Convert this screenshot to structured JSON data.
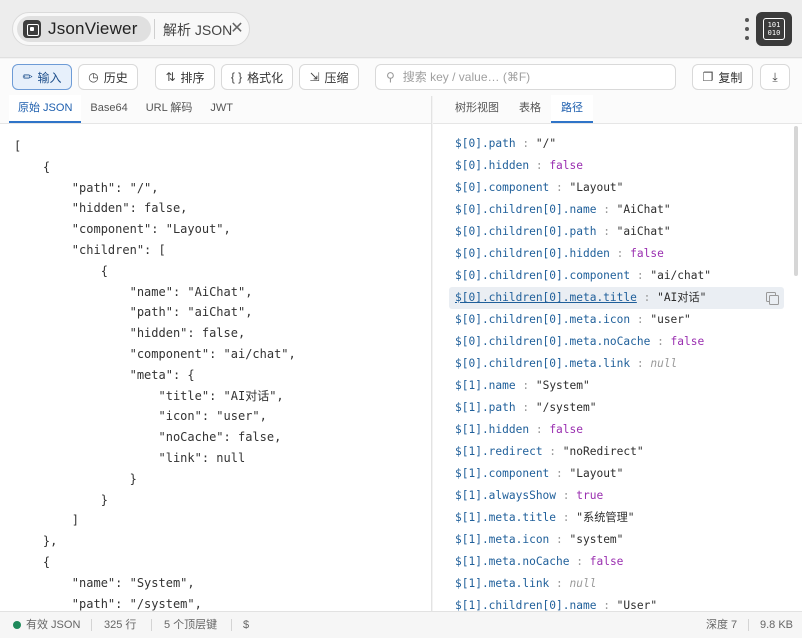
{
  "window": {
    "app_title": "JsonViewer",
    "doc_tab": "解析 JSON",
    "close_glyph": "✕",
    "ext_icon_text": "101\n010"
  },
  "toolbar": {
    "input": "输入",
    "history": "历史",
    "sort": "排序",
    "format": "格式化",
    "compress": "压缩",
    "search_placeholder": "搜索 key / value… (⌘F)",
    "copy": "复制"
  },
  "left_tabs": [
    "原始 JSON",
    "Base64",
    "URL 解码",
    "JWT"
  ],
  "right_tabs": [
    "树形视图",
    "表格",
    "路径"
  ],
  "raw_json_lines": [
    "[",
    "    {",
    "        \"path\": \"/\",",
    "        \"hidden\": false,",
    "        \"component\": \"Layout\",",
    "        \"children\": [",
    "            {",
    "                \"name\": \"AiChat\",",
    "                \"path\": \"aiChat\",",
    "                \"hidden\": false,",
    "                \"component\": \"ai/chat\",",
    "                \"meta\": {",
    "                    \"title\": \"AI对话\",",
    "                    \"icon\": \"user\",",
    "                    \"noCache\": false,",
    "                    \"link\": null",
    "                }",
    "            }",
    "        ]",
    "    },",
    "    {",
    "        \"name\": \"System\",",
    "        \"path\": \"/system\","
  ],
  "path_rows": [
    {
      "path": "$[0].path",
      "value": "\"/\"",
      "kind": "str"
    },
    {
      "path": "$[0].hidden",
      "value": "false",
      "kind": "bool"
    },
    {
      "path": "$[0].component",
      "value": "\"Layout\"",
      "kind": "str"
    },
    {
      "path": "$[0].children[0].name",
      "value": "\"AiChat\"",
      "kind": "str"
    },
    {
      "path": "$[0].children[0].path",
      "value": "\"aiChat\"",
      "kind": "str"
    },
    {
      "path": "$[0].children[0].hidden",
      "value": "false",
      "kind": "bool"
    },
    {
      "path": "$[0].children[0].component",
      "value": "\"ai/chat\"",
      "kind": "str"
    },
    {
      "path": "$[0].children[0].meta.title",
      "value": "\"AI对话\"",
      "kind": "str",
      "highlight": true
    },
    {
      "path": "$[0].children[0].meta.icon",
      "value": "\"user\"",
      "kind": "str"
    },
    {
      "path": "$[0].children[0].meta.noCache",
      "value": "false",
      "kind": "bool"
    },
    {
      "path": "$[0].children[0].meta.link",
      "value": "null",
      "kind": "null"
    },
    {
      "path": "$[1].name",
      "value": "\"System\"",
      "kind": "str"
    },
    {
      "path": "$[1].path",
      "value": "\"/system\"",
      "kind": "str"
    },
    {
      "path": "$[1].hidden",
      "value": "false",
      "kind": "bool"
    },
    {
      "path": "$[1].redirect",
      "value": "\"noRedirect\"",
      "kind": "str"
    },
    {
      "path": "$[1].component",
      "value": "\"Layout\"",
      "kind": "str"
    },
    {
      "path": "$[1].alwaysShow",
      "value": "true",
      "kind": "bool"
    },
    {
      "path": "$[1].meta.title",
      "value": "\"系统管理\"",
      "kind": "str"
    },
    {
      "path": "$[1].meta.icon",
      "value": "\"system\"",
      "kind": "str"
    },
    {
      "path": "$[1].meta.noCache",
      "value": "false",
      "kind": "bool"
    },
    {
      "path": "$[1].meta.link",
      "value": "null",
      "kind": "null"
    },
    {
      "path": "$[1].children[0].name",
      "value": "\"User\"",
      "kind": "str"
    }
  ],
  "path_separator": " : ",
  "status": {
    "valid": "有效 JSON",
    "lines": "325 行",
    "top_keys": "5 个顶层键",
    "root": "$",
    "depth": "深度 7",
    "size": "9.8 KB"
  },
  "colors": {
    "accent": "#2f74c8",
    "valid_dot": "#1f8a5b",
    "bool_value": "#9a2fb0",
    "path_key": "#1f5f9a"
  },
  "icons": {
    "input": "input-icon",
    "history": "history-icon",
    "sort": "sort-icon",
    "format": "braces-icon",
    "compress": "compress-icon",
    "search": "search-icon",
    "copy": "copy-icon",
    "download": "download-icon"
  }
}
